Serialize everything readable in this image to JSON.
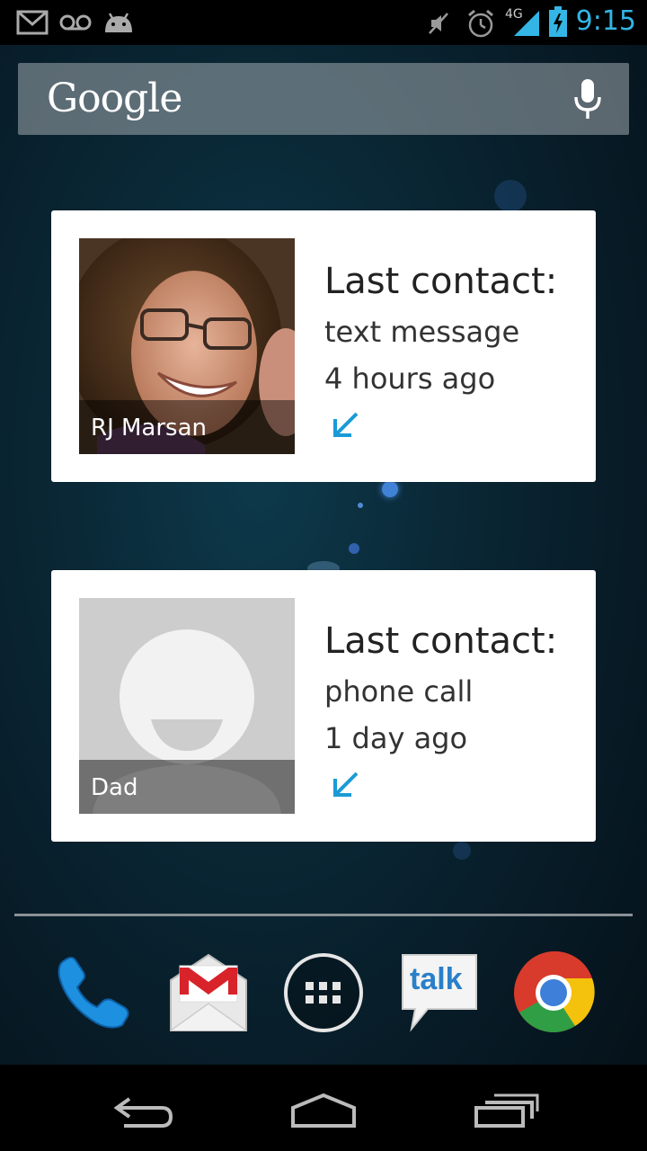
{
  "status_bar": {
    "time": "9:15",
    "network": "4G",
    "icons": [
      "gmail-icon",
      "voicemail-icon",
      "android-icon",
      "mute-icon",
      "alarm-icon",
      "signal-icon",
      "battery-charging-icon"
    ]
  },
  "search": {
    "logo": "Google",
    "mic_icon": "microphone-icon"
  },
  "contacts": [
    {
      "name": "RJ Marsan",
      "title": "Last contact:",
      "method": "text message",
      "when": "4 hours ago",
      "direction_icon": "incoming-arrow-icon"
    },
    {
      "name": "Dad",
      "title": "Last contact:",
      "method": "phone call",
      "when": "1 day ago",
      "direction_icon": "incoming-arrow-icon"
    }
  ],
  "dock": {
    "icons": [
      "phone-icon",
      "gmail-icon",
      "app-drawer-icon",
      "talk-icon",
      "chrome-icon"
    ],
    "talk_label": "talk"
  },
  "nav": {
    "icons": [
      "back-icon",
      "home-icon",
      "recent-apps-icon"
    ]
  },
  "colors": {
    "accent": "#33b5e5",
    "arrow": "#1a9bd6",
    "card_bg": "#ffffff"
  }
}
